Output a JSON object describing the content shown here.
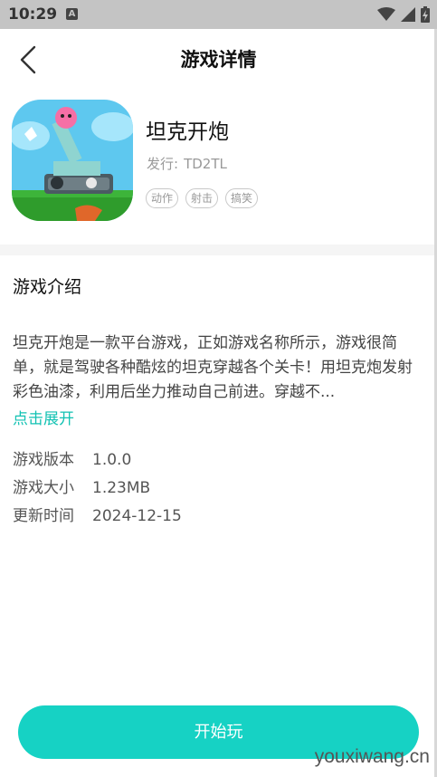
{
  "status_bar": {
    "time": "10:29",
    "notification_glyph": "A",
    "icons": [
      "wifi-icon",
      "signal-icon",
      "battery-icon"
    ]
  },
  "nav": {
    "title": "游戏详情",
    "back_icon": "chevron-left-icon"
  },
  "game": {
    "name": "坦克开炮",
    "publisher_label": "发行:",
    "publisher": "TD2TL",
    "tags": [
      "动作",
      "射击",
      "搞笑"
    ]
  },
  "intro": {
    "section_title": "游戏介绍",
    "text": "坦克开炮是一款平台游戏，正如游戏名称所示，游戏很简单，就是驾驶各种酷炫的坦克穿越各个关卡！用坦克炮发射彩色油漆，利用后坐力推动自己前进。穿越不...",
    "expand_label": "点击展开"
  },
  "info": [
    {
      "label": "游戏版本",
      "value": "1.0.0"
    },
    {
      "label": "游戏大小",
      "value": "1.23MB"
    },
    {
      "label": "更新时间",
      "value": "2024-12-15"
    }
  ],
  "actions": {
    "start_label": "开始玩"
  },
  "watermark": "youxiwang.cn",
  "colors": {
    "accent": "#16d2c4",
    "link": "#12c2b3",
    "status_bar": "#c4c4c4"
  }
}
